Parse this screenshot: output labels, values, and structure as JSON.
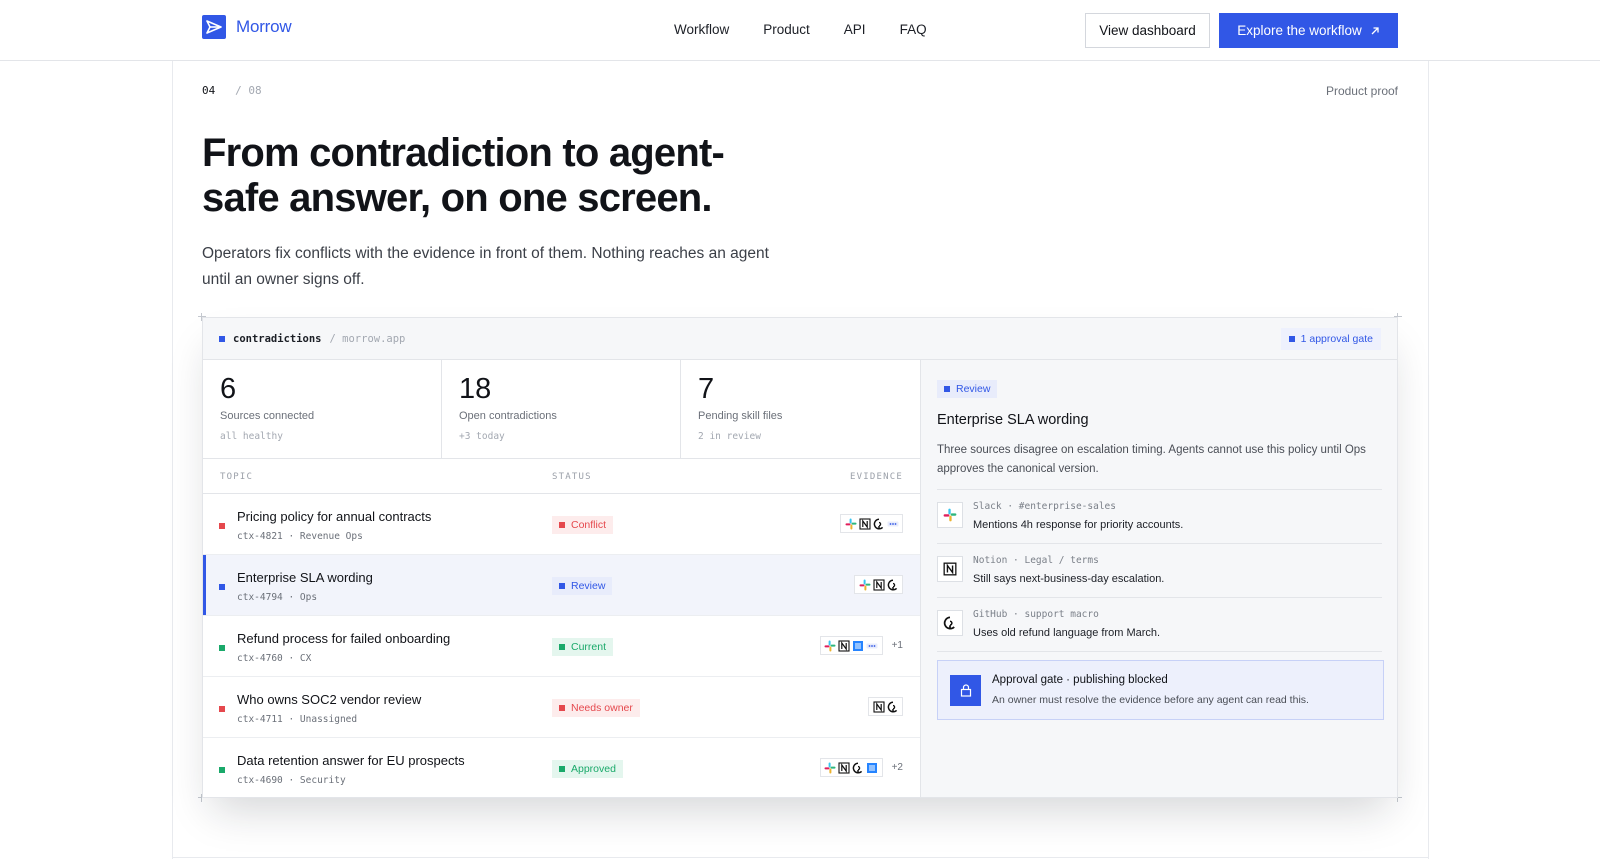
{
  "nav": {
    "brand": "Morrow",
    "links": [
      "Workflow",
      "Product",
      "API",
      "FAQ"
    ],
    "secondary_cta": "View dashboard",
    "primary_cta": "Explore the workflow",
    "accent": "#3157e6"
  },
  "section": {
    "index": "04",
    "total": "/ 08",
    "tag": "Product proof",
    "headline": "From contradiction to agent-safe answer, on one screen.",
    "subhead": "Operators fix conflicts with the evidence in front of them. Nothing reaches an agent until an owner signs off."
  },
  "app": {
    "header_title": "contradictions",
    "header_sub": "/ morrow.app",
    "gate_label": "1 approval gate",
    "stats": [
      {
        "value": "6",
        "label": "Sources connected",
        "note": "all healthy"
      },
      {
        "value": "18",
        "label": "Open contradictions",
        "note": "+3 today"
      },
      {
        "value": "7",
        "label": "Pending skill files",
        "note": "2 in review"
      }
    ],
    "columns": {
      "topic": "TOPIC",
      "status": "STATUS",
      "evidence": "EVIDENCE"
    },
    "rows": [
      {
        "title": "Pricing policy for annual contracts",
        "meta": "ctx-4821 · Revenue Ops",
        "status": "Conflict",
        "status_color": "#e5484d",
        "icons": [
          "slack-icon",
          "notion-icon",
          "github-icon",
          "gong-icon"
        ],
        "more": ""
      },
      {
        "title": "Enterprise SLA wording",
        "meta": "ctx-4794 · Ops",
        "status": "Review",
        "status_color": "#3157e6",
        "icons": [
          "slack-icon",
          "notion-icon",
          "github-icon"
        ],
        "more": ""
      },
      {
        "title": "Refund process for failed onboarding",
        "meta": "ctx-4760 · CX",
        "status": "Current",
        "status_color": "#1aa96a",
        "icons": [
          "slack-icon",
          "notion-icon",
          "confluence-icon",
          "gong-icon"
        ],
        "more": "+1"
      },
      {
        "title": "Who owns SOC2 vendor review",
        "meta": "ctx-4711 · Unassigned",
        "status": "Needs owner",
        "status_color": "#e5484d",
        "icons": [
          "notion-icon",
          "github-icon"
        ],
        "more": ""
      },
      {
        "title": "Data retention answer for EU prospects",
        "meta": "ctx-4690 · Security",
        "status": "Approved",
        "status_color": "#1aa96a",
        "icons": [
          "slack-icon",
          "notion-icon",
          "github-icon",
          "confluence-icon"
        ],
        "more": "+2"
      }
    ],
    "panel": {
      "badge": "Review",
      "title": "Enterprise SLA wording",
      "description": "Three sources disagree on escalation timing. Agents cannot use this policy until Ops approves the canonical version.",
      "evidence": [
        {
          "icon": "slack-icon",
          "source": "Slack · #enterprise-sales",
          "text": "Mentions 4h response for priority accounts."
        },
        {
          "icon": "notion-icon",
          "source": "Notion · Legal / terms",
          "text": "Still says next-business-day escalation."
        },
        {
          "icon": "github-icon",
          "source": "GitHub · support macro",
          "text": "Uses old refund language from March."
        }
      ],
      "approval_title": "Approval gate · publishing blocked",
      "approval_desc": "An owner must resolve the evidence before any agent can read this."
    }
  }
}
